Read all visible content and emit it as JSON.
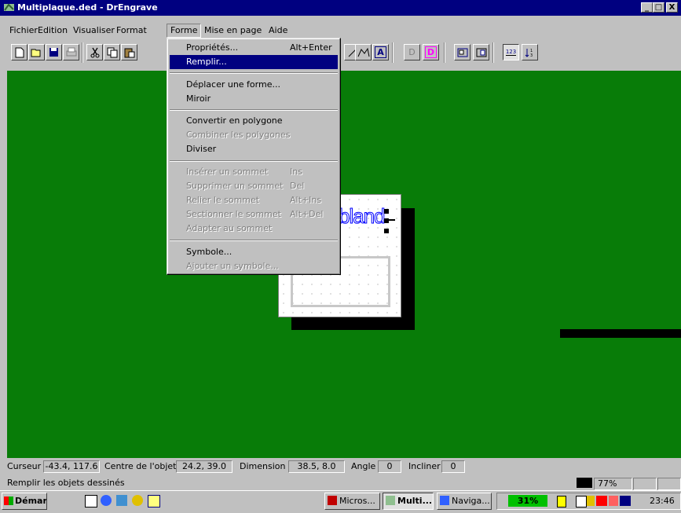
{
  "window": {
    "title": "Multiplaque.ded - DrEngrave",
    "controls": {
      "minimize": "_",
      "maximize": "□",
      "close": "X"
    }
  },
  "menubar": {
    "items": [
      {
        "label": "Fichier"
      },
      {
        "label": "Edition"
      },
      {
        "label": "Visualiser"
      },
      {
        "label": "Format"
      },
      {
        "label": "Forme"
      },
      {
        "label": "Mise en page"
      },
      {
        "label": "Aide"
      }
    ]
  },
  "toolbar": {
    "buttons": [
      "new-icon",
      "open-icon",
      "save-icon",
      "print-icon",
      "cut-icon",
      "copy-icon",
      "paste-icon",
      "line-icon",
      "polyline-icon",
      "text-icon",
      "d-icon",
      "d-magenta-icon",
      "group-icon",
      "ungroup-icon",
      "numbering-icon",
      "sequence-icon"
    ],
    "text_btn": "A",
    "d_btn": "D",
    "num_btn": "123"
  },
  "dropdown": {
    "items": [
      {
        "label": "Propriétés...",
        "shortcut": "Alt+Enter",
        "state": "enabled"
      },
      {
        "label": "Remplir...",
        "shortcut": "",
        "state": "highlighted"
      },
      {
        "separator": true
      },
      {
        "label": "Déplacer une forme...",
        "shortcut": "",
        "state": "enabled"
      },
      {
        "label": "Miroir",
        "shortcut": "",
        "state": "enabled"
      },
      {
        "separator": true
      },
      {
        "label": "Convertir en polygone",
        "shortcut": "",
        "state": "enabled"
      },
      {
        "label": "Combiner les polygones",
        "shortcut": "",
        "state": "disabled"
      },
      {
        "label": "Diviser",
        "shortcut": "",
        "state": "enabled"
      },
      {
        "separator": true
      },
      {
        "label": "Insérer un sommet",
        "shortcut": "Ins",
        "state": "disabled"
      },
      {
        "label": "Supprimer un sommet",
        "shortcut": "Del",
        "state": "disabled"
      },
      {
        "label": "Relier le sommet",
        "shortcut": "Alt+Ins",
        "state": "disabled"
      },
      {
        "label": "Sectionner le sommet",
        "shortcut": "Alt+Del",
        "state": "disabled"
      },
      {
        "label": "Adapter au sommet",
        "shortcut": "",
        "state": "disabled"
      },
      {
        "separator": true
      },
      {
        "label": "Symbole...",
        "shortcut": "",
        "state": "enabled"
      },
      {
        "label": "Ajouter un symbole...",
        "shortcut": "",
        "state": "disabled"
      }
    ]
  },
  "canvas": {
    "background": "#087c08",
    "plate_text": "bland"
  },
  "statusbar": {
    "cursor_label": "Curseur",
    "cursor_value": "-43.4, 117.6",
    "center_label": "Centre de l'objet",
    "center_value": "24.2, 39.0",
    "dimension_label": "Dimension",
    "dimension_value": "38.5, 8.0",
    "angle_label": "Angle",
    "angle_value": "0",
    "incline_label": "Incliner",
    "incline_value": "0",
    "help_text": "Remplir les objets dessinés",
    "zoom": "77%"
  },
  "taskbar": {
    "start_label": "Démarrer",
    "tasks": [
      {
        "label": "Micros...",
        "active": false
      },
      {
        "label": "Multi...",
        "active": true
      },
      {
        "label": "Naviga...",
        "active": false
      }
    ],
    "battery": "31%",
    "clock": "23:46"
  }
}
